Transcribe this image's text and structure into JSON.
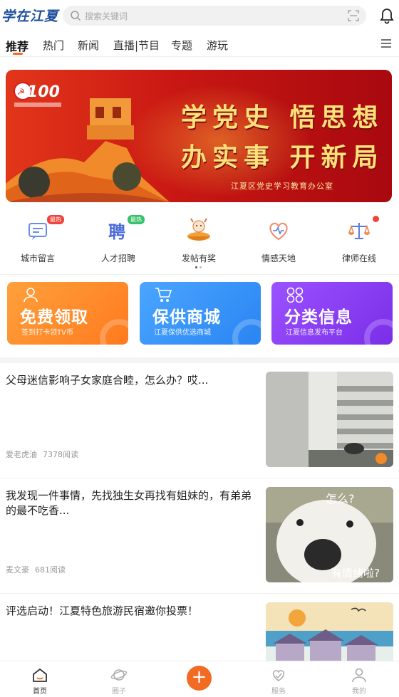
{
  "header": {
    "logo_text": "学在江夏",
    "search_placeholder": "搜索关键词"
  },
  "tabs": [
    {
      "label": "推荐",
      "active": true
    },
    {
      "label": "热门"
    },
    {
      "label": "新闻"
    },
    {
      "label": "直播|节目"
    },
    {
      "label": "专题"
    },
    {
      "label": "游玩"
    }
  ],
  "banner": {
    "line1": "学党史 悟思想",
    "line2": "办实事 开新局",
    "subtitle": "江夏区党史学习教育办公室",
    "badge_text": "100"
  },
  "quick_icons": [
    {
      "label": "城市留言",
      "tag": "最热",
      "icon": "message-icon"
    },
    {
      "label": "人才招聘",
      "tag": "最热",
      "icon": "recruit-icon"
    },
    {
      "label": "发帖有奖",
      "icon": "reward-icon"
    },
    {
      "label": "情感天地",
      "icon": "heart-icon"
    },
    {
      "label": "律师在线",
      "icon": "scale-icon"
    }
  ],
  "promo_cards": [
    {
      "title": "免费领取",
      "subtitle": "签到打卡领TV币",
      "color": "#ff8a2b"
    },
    {
      "title": "保供商城",
      "subtitle": "江夏保供优选商城",
      "color": "#2f8ff6"
    },
    {
      "title": "分类信息",
      "subtitle": "江夏信息发布平台",
      "color": "#8a3cf2"
    }
  ],
  "feed": [
    {
      "title": "父母迷信影响子女家庭合睦，怎么办？哎...",
      "author": "爱老虎油",
      "reads": "7378阅读"
    },
    {
      "title": "我发现一件事情，先找独生女再找有姐妹的，有弟弟的最不吃香...",
      "author": "麦文豪",
      "reads": "681阅读",
      "img_top": "怎么?",
      "img_bottom": "有情绪啦?"
    },
    {
      "title": "评选启动！江夏特色旅游民宿邀你投票！"
    }
  ],
  "bottom_nav": [
    {
      "label": "首页",
      "active": true
    },
    {
      "label": "圈子"
    },
    {
      "label": "+"
    },
    {
      "label": "服务"
    },
    {
      "label": "我的"
    }
  ],
  "colors": {
    "accent": "#f26b22",
    "logo": "#1d4f9c",
    "banner_red": "#c81713",
    "banner_gold": "#ffe17a"
  }
}
